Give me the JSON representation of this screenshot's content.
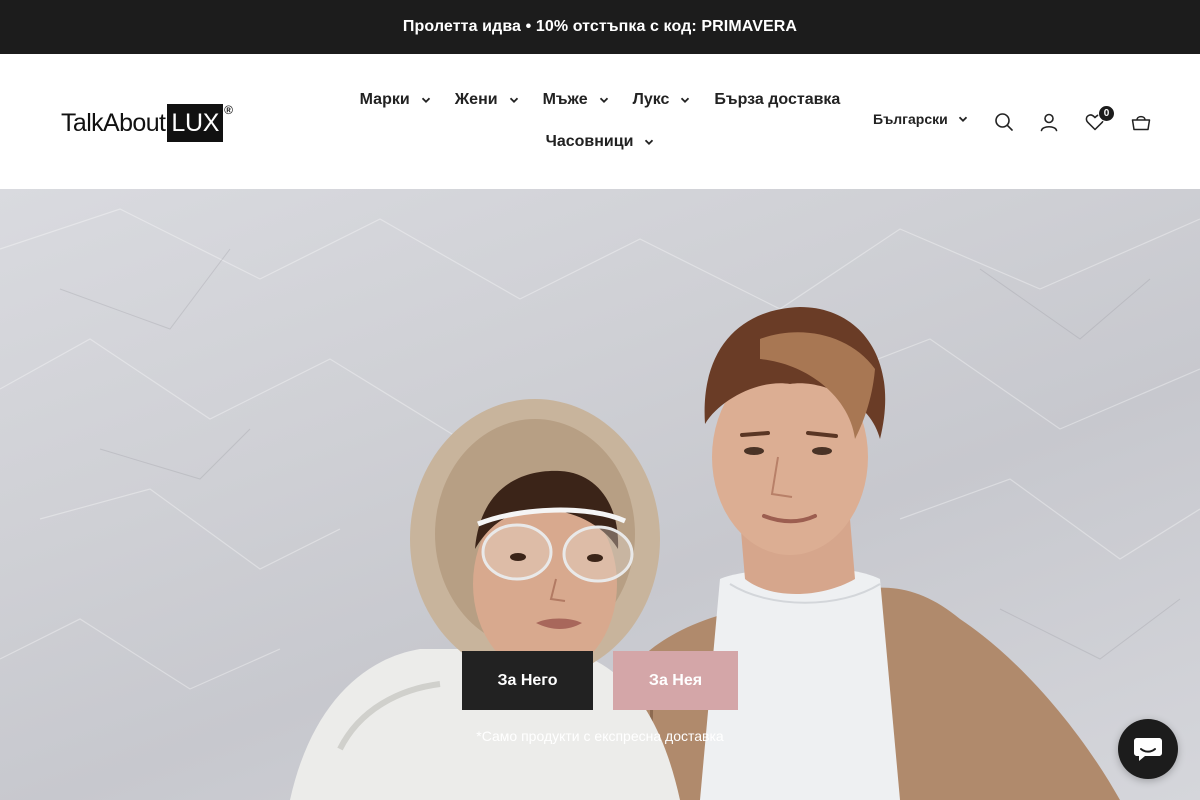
{
  "announcement": {
    "text": "Пролетта идва • 10% отстъпка с код: PRIMAVERA"
  },
  "logo": {
    "part1": "TalkAbout",
    "part2": "LUX",
    "mark": "®"
  },
  "nav": {
    "row1": [
      {
        "label": "Марки",
        "dropdown": true
      },
      {
        "label": "Жени",
        "dropdown": true
      },
      {
        "label": "Мъже",
        "dropdown": true
      },
      {
        "label": "Лукс",
        "dropdown": true
      },
      {
        "label": "Бърза доставка",
        "dropdown": false
      }
    ],
    "row2": [
      {
        "label": "Часовници",
        "dropdown": true
      }
    ]
  },
  "header_actions": {
    "language": "Български",
    "icons": [
      "search-icon",
      "account-icon",
      "wishlist-heart-icon",
      "cart-basket-icon"
    ],
    "wishlist_count": "0"
  },
  "hero": {
    "button_him": "За Него",
    "button_her": "За Нея",
    "note": "*Само продукти с експресна доставка"
  },
  "chat": {
    "icon": "chat-bubble-icon"
  },
  "colors": {
    "announcement_bg": "#1c1c1c",
    "button_him_bg": "#222222",
    "button_her_bg": "#d4a6a8"
  }
}
